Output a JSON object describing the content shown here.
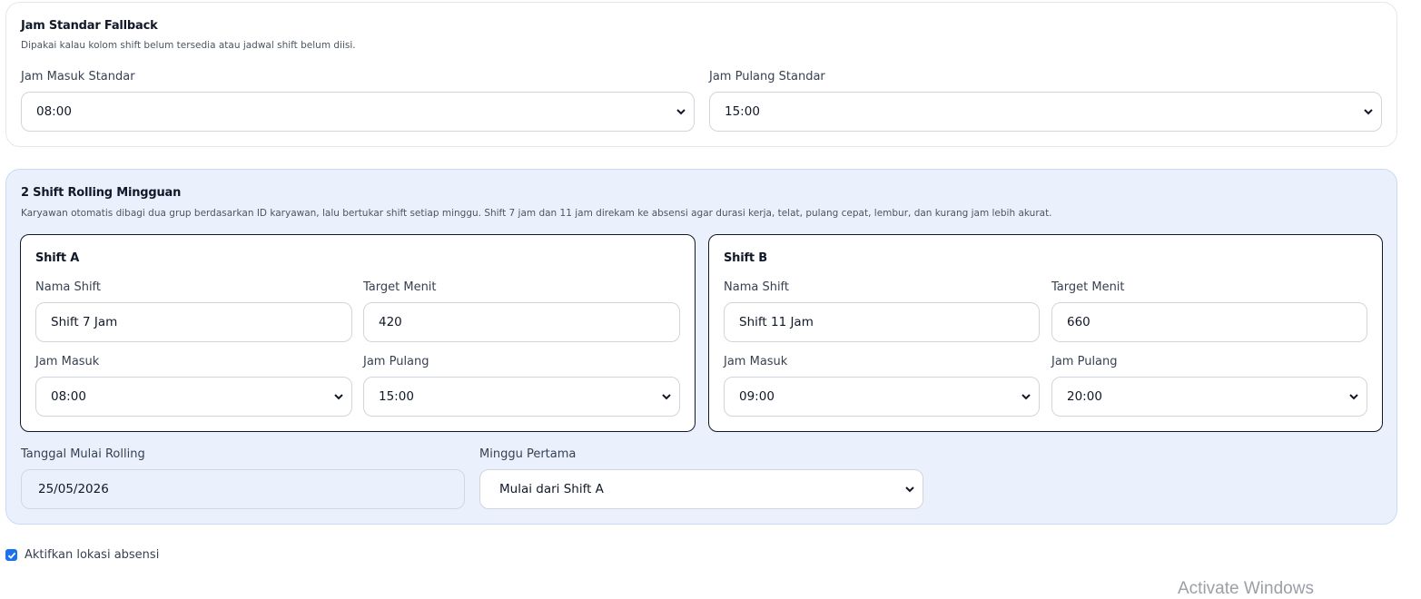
{
  "fallback": {
    "title": "Jam Standar Fallback",
    "description": "Dipakai kalau kolom shift belum tersedia atau jadwal shift belum diisi.",
    "jam_masuk_label": "Jam Masuk Standar",
    "jam_masuk_value": "08:00",
    "jam_pulang_label": "Jam Pulang Standar",
    "jam_pulang_value": "15:00"
  },
  "rolling": {
    "title": "2 Shift Rolling Mingguan",
    "description": "Karyawan otomatis dibagi dua grup berdasarkan ID karyawan, lalu bertukar shift setiap minggu. Shift 7 jam dan 11 jam direkam ke absensi agar durasi kerja, telat, pulang cepat, lembur, dan kurang jam lebih akurat.",
    "shift_a": {
      "title": "Shift A",
      "nama_label": "Nama Shift",
      "nama_value": "Shift 7 Jam",
      "target_label": "Target Menit",
      "target_value": "420",
      "masuk_label": "Jam Masuk",
      "masuk_value": "08:00",
      "pulang_label": "Jam Pulang",
      "pulang_value": "15:00"
    },
    "shift_b": {
      "title": "Shift B",
      "nama_label": "Nama Shift",
      "nama_value": "Shift 11 Jam",
      "target_label": "Target Menit",
      "target_value": "660",
      "masuk_label": "Jam Masuk",
      "masuk_value": "09:00",
      "pulang_label": "Jam Pulang",
      "pulang_value": "20:00"
    },
    "tanggal_label": "Tanggal Mulai Rolling",
    "tanggal_value": "25/05/2026",
    "minggu_label": "Minggu Pertama",
    "minggu_value": "Mulai dari Shift A"
  },
  "lokasi": {
    "label": "Aktifkan lokasi absensi",
    "checked": true
  },
  "watermark": "Activate Windows",
  "colors": {
    "accent": "#1a73e8",
    "rolling_bg": "#eaf1fd"
  }
}
